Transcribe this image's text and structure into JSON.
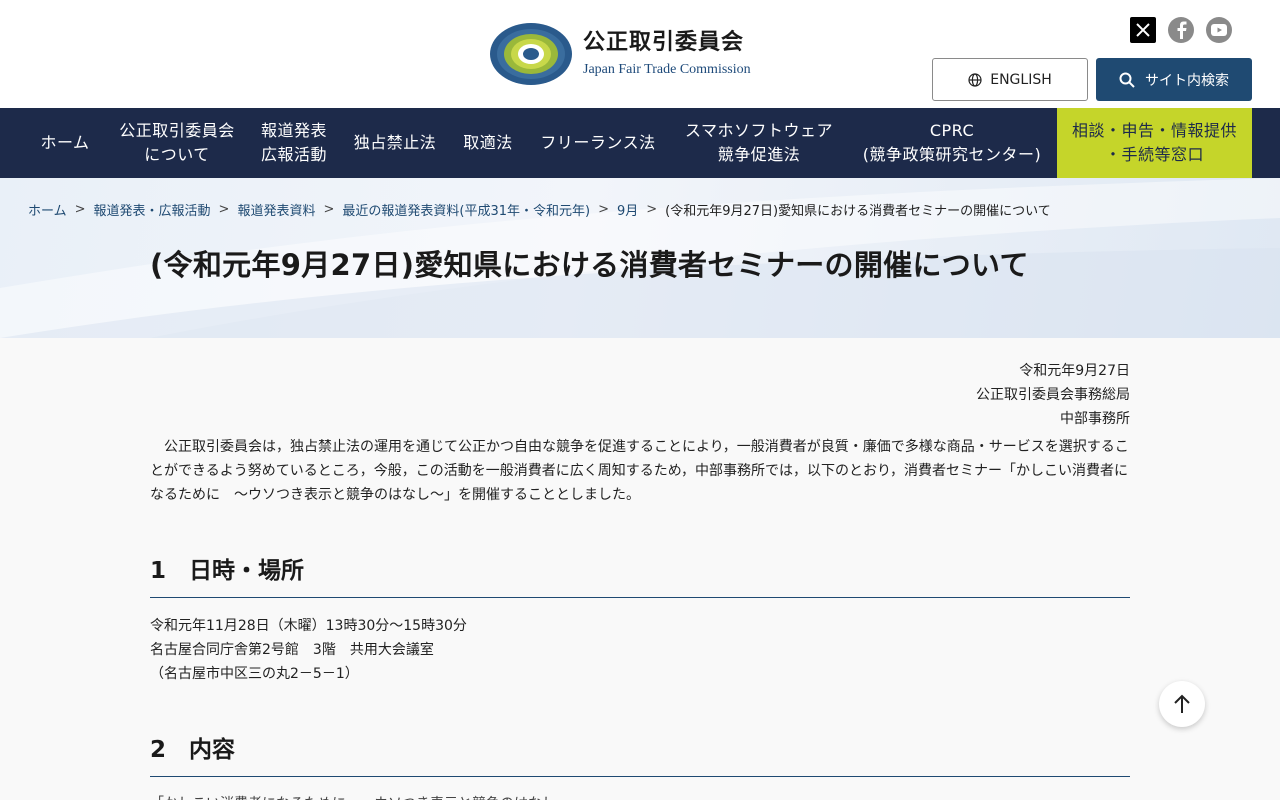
{
  "header": {
    "org_name_jp": "公正取引委員会",
    "org_name_en": "Japan Fair Trade Commission",
    "logo_ring_text": "JAPAN FAIR TRADE COMMISSION",
    "english_button": "ENGLISH",
    "search_button": "サイト内検索",
    "social": [
      "x-icon",
      "facebook-icon",
      "youtube-icon"
    ]
  },
  "nav": {
    "items": [
      {
        "line1": "ホーム",
        "line2": ""
      },
      {
        "line1": "公正取引委員会",
        "line2": "について"
      },
      {
        "line1": "報道発表",
        "line2": "広報活動"
      },
      {
        "line1": "独占禁止法",
        "line2": ""
      },
      {
        "line1": "取適法",
        "line2": ""
      },
      {
        "line1": "フリーランス法",
        "line2": ""
      },
      {
        "line1": "スマホソフトウェア",
        "line2": "競争促進法"
      },
      {
        "line1": "CPRC",
        "line2": "(競争政策研究センター)"
      },
      {
        "line1": "相談・申告・情報提供",
        "line2": "・手続等窓口"
      }
    ]
  },
  "breadcrumb": {
    "items": [
      "ホーム",
      "報道発表・広報活動",
      "報道発表資料",
      "最近の報道発表資料(平成31年・令和元年)",
      "9月"
    ],
    "current": "(令和元年9月27日)愛知県における消費者セミナーの開催について",
    "separator": ">"
  },
  "page": {
    "title": "(令和元年9月27日)愛知県における消費者セミナーの開催について",
    "date": "令和元年9月27日",
    "issuer": "公正取引委員会事務総局",
    "office": "中部事務所",
    "lead": "公正取引委員会は，独占禁止法の運用を通じて公正かつ自由な競争を促進することにより，一般消費者が良質・廉価で多様な商品・サービスを選択することができるよう努めているところ，今般，この活動を一般消費者に広く周知するため，中部事務所では，以下のとおり，消費者セミナー「かしこい消費者になるために　～ウソつき表示と競争のはなし～」を開催することとしました。"
  },
  "section1": {
    "heading": "1　日時・場所",
    "lines": [
      "令和元年11月28日（木曜）13時30分～15時30分",
      "名古屋合同庁舎第2号館　3階　共用大会議室",
      "（名古屋市中区三の丸2－5－1）"
    ]
  },
  "section2": {
    "heading": "2　内容",
    "partial": "「かしこい消費者になるために　～ウソつき表示と競争のはなし～」"
  },
  "back_to_top": "arrow-up-icon",
  "colors": {
    "nav_bg": "#1d2a4a",
    "accent": "#c5d52a",
    "primary": "#1f4a72"
  }
}
